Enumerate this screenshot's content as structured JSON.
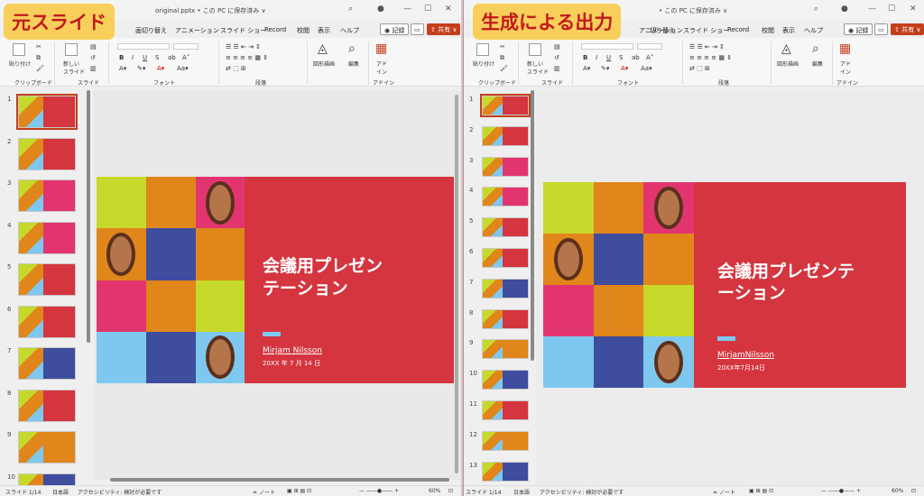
{
  "left_badge": "元スライド",
  "right_badge": "生成による出力",
  "left": {
    "titlebar_file": "original.pptx • この PC に保存済み ∨",
    "tabs": [
      "画切り替え",
      "アニメーション",
      "スライド ショー",
      "Record",
      "校閲",
      "表示",
      "ヘルプ"
    ],
    "record_label": "記録",
    "share_label": "共有",
    "ribbon": {
      "paste": "貼り付け",
      "new_slide": "新しい\nスライド",
      "drawing": "図形描画",
      "edit": "編集",
      "designer": "アド\nイン",
      "group_clipboard": "クリップボード",
      "group_slide": "スライド",
      "group_font": "フォント",
      "group_paragraph": "段落",
      "group_addin": "アドイン"
    },
    "slide_numbers": [
      "1",
      "2",
      "3",
      "4",
      "5",
      "6",
      "7",
      "8",
      "9",
      "10"
    ],
    "slide": {
      "title": "会議用プレゼン\nテーション",
      "name": "Mirjam Nilsson",
      "date": "20XX 年 7 月 14 日"
    },
    "status": {
      "slide": "スライド 1/14",
      "lang": "日本語",
      "access": "アクセシビリティ: 検討が必要です",
      "notes": "ノート",
      "zoom": "60%"
    }
  },
  "right": {
    "titlebar_file": "• この PC に保存済み ∨",
    "tabs": [
      "切り替え",
      "アニメーション",
      "スライド ショー",
      "Record",
      "校閲",
      "表示",
      "ヘルプ"
    ],
    "record_label": "記録",
    "share_label": "共有",
    "ribbon": {
      "paste": "貼り付け",
      "new_slide": "新しい\nスライド",
      "drawing": "図形描画",
      "edit": "編集",
      "designer": "アド\nイン",
      "group_clipboard": "クリップボード",
      "group_slide": "スライド",
      "group_font": "フォント",
      "group_paragraph": "段落",
      "group_addin": "アドイン"
    },
    "slide_numbers": [
      "1",
      "2",
      "3",
      "4",
      "5",
      "6",
      "7",
      "8",
      "9",
      "10",
      "11",
      "12",
      "13"
    ],
    "slide": {
      "title": "会議用プレゼンテ\nーション",
      "name": "MirjamNilsson",
      "date": "20XX年7月14日"
    },
    "status": {
      "slide": "スライド 1/14",
      "lang": "日本語",
      "access": "アクセシビリティ: 検討が必要です",
      "notes": "ノート",
      "zoom": "60%"
    }
  },
  "colors": {
    "lime": "#c6d92b",
    "orange": "#e0861a",
    "navy": "#3e4d9e",
    "red": "#d4353f",
    "pink": "#e2356f",
    "sky": "#7ec8ef",
    "accent": "#c43e1c"
  }
}
